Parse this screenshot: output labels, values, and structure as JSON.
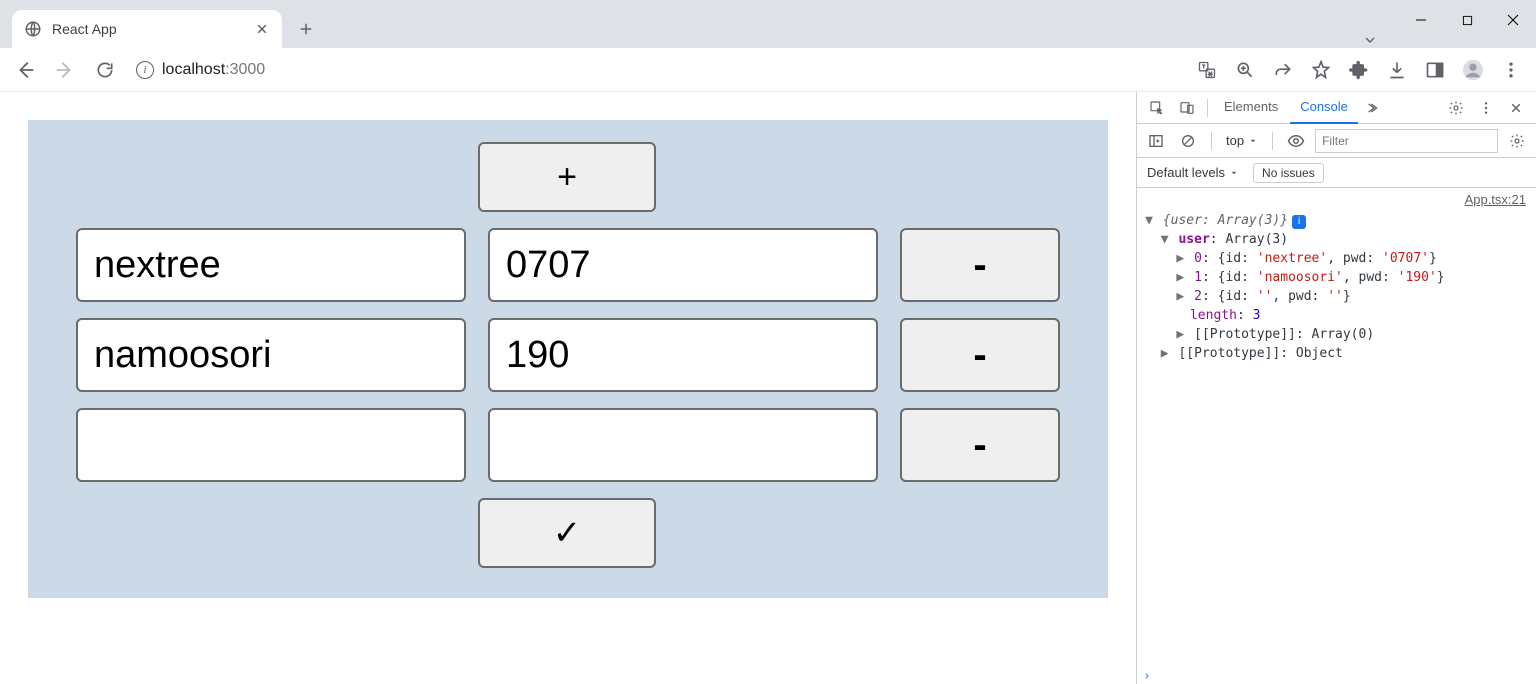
{
  "browser": {
    "tab_title": "React App",
    "url_host": "localhost",
    "url_rest": ":3000"
  },
  "app": {
    "add_label": "+",
    "submit_label": "✓",
    "remove_label": "-",
    "rows": [
      {
        "id": "nextree",
        "pwd": "0707"
      },
      {
        "id": "namoosori",
        "pwd": "190"
      },
      {
        "id": "",
        "pwd": ""
      }
    ]
  },
  "devtools": {
    "tab_elements": "Elements",
    "tab_console": "Console",
    "context_label": "top",
    "filter_placeholder": "Filter",
    "levels_label": "Default levels",
    "issues_label": "No issues",
    "source_ref": "App.tsx:21",
    "log": {
      "summary_pre": "{user: ",
      "summary_type": "Array(3)",
      "summary_post": "}",
      "user_key": "user",
      "user_type": "Array(3)",
      "items": [
        {
          "idx": "0",
          "repr_pre": "{id: ",
          "id": "'nextree'",
          "mid": ", pwd: ",
          "pwd": "'0707'",
          "post": "}"
        },
        {
          "idx": "1",
          "repr_pre": "{id: ",
          "id": "'namoosori'",
          "mid": ", pwd: ",
          "pwd": "'190'",
          "post": "}"
        },
        {
          "idx": "2",
          "repr_pre": "{id: ",
          "id": "''",
          "mid": ", pwd: ",
          "pwd": "''",
          "post": "}"
        }
      ],
      "length_key": "length",
      "length_val": "3",
      "proto_arr": "[[Prototype]]",
      "proto_arr_val": "Array(0)",
      "proto_obj": "[[Prototype]]",
      "proto_obj_val": "Object"
    }
  }
}
